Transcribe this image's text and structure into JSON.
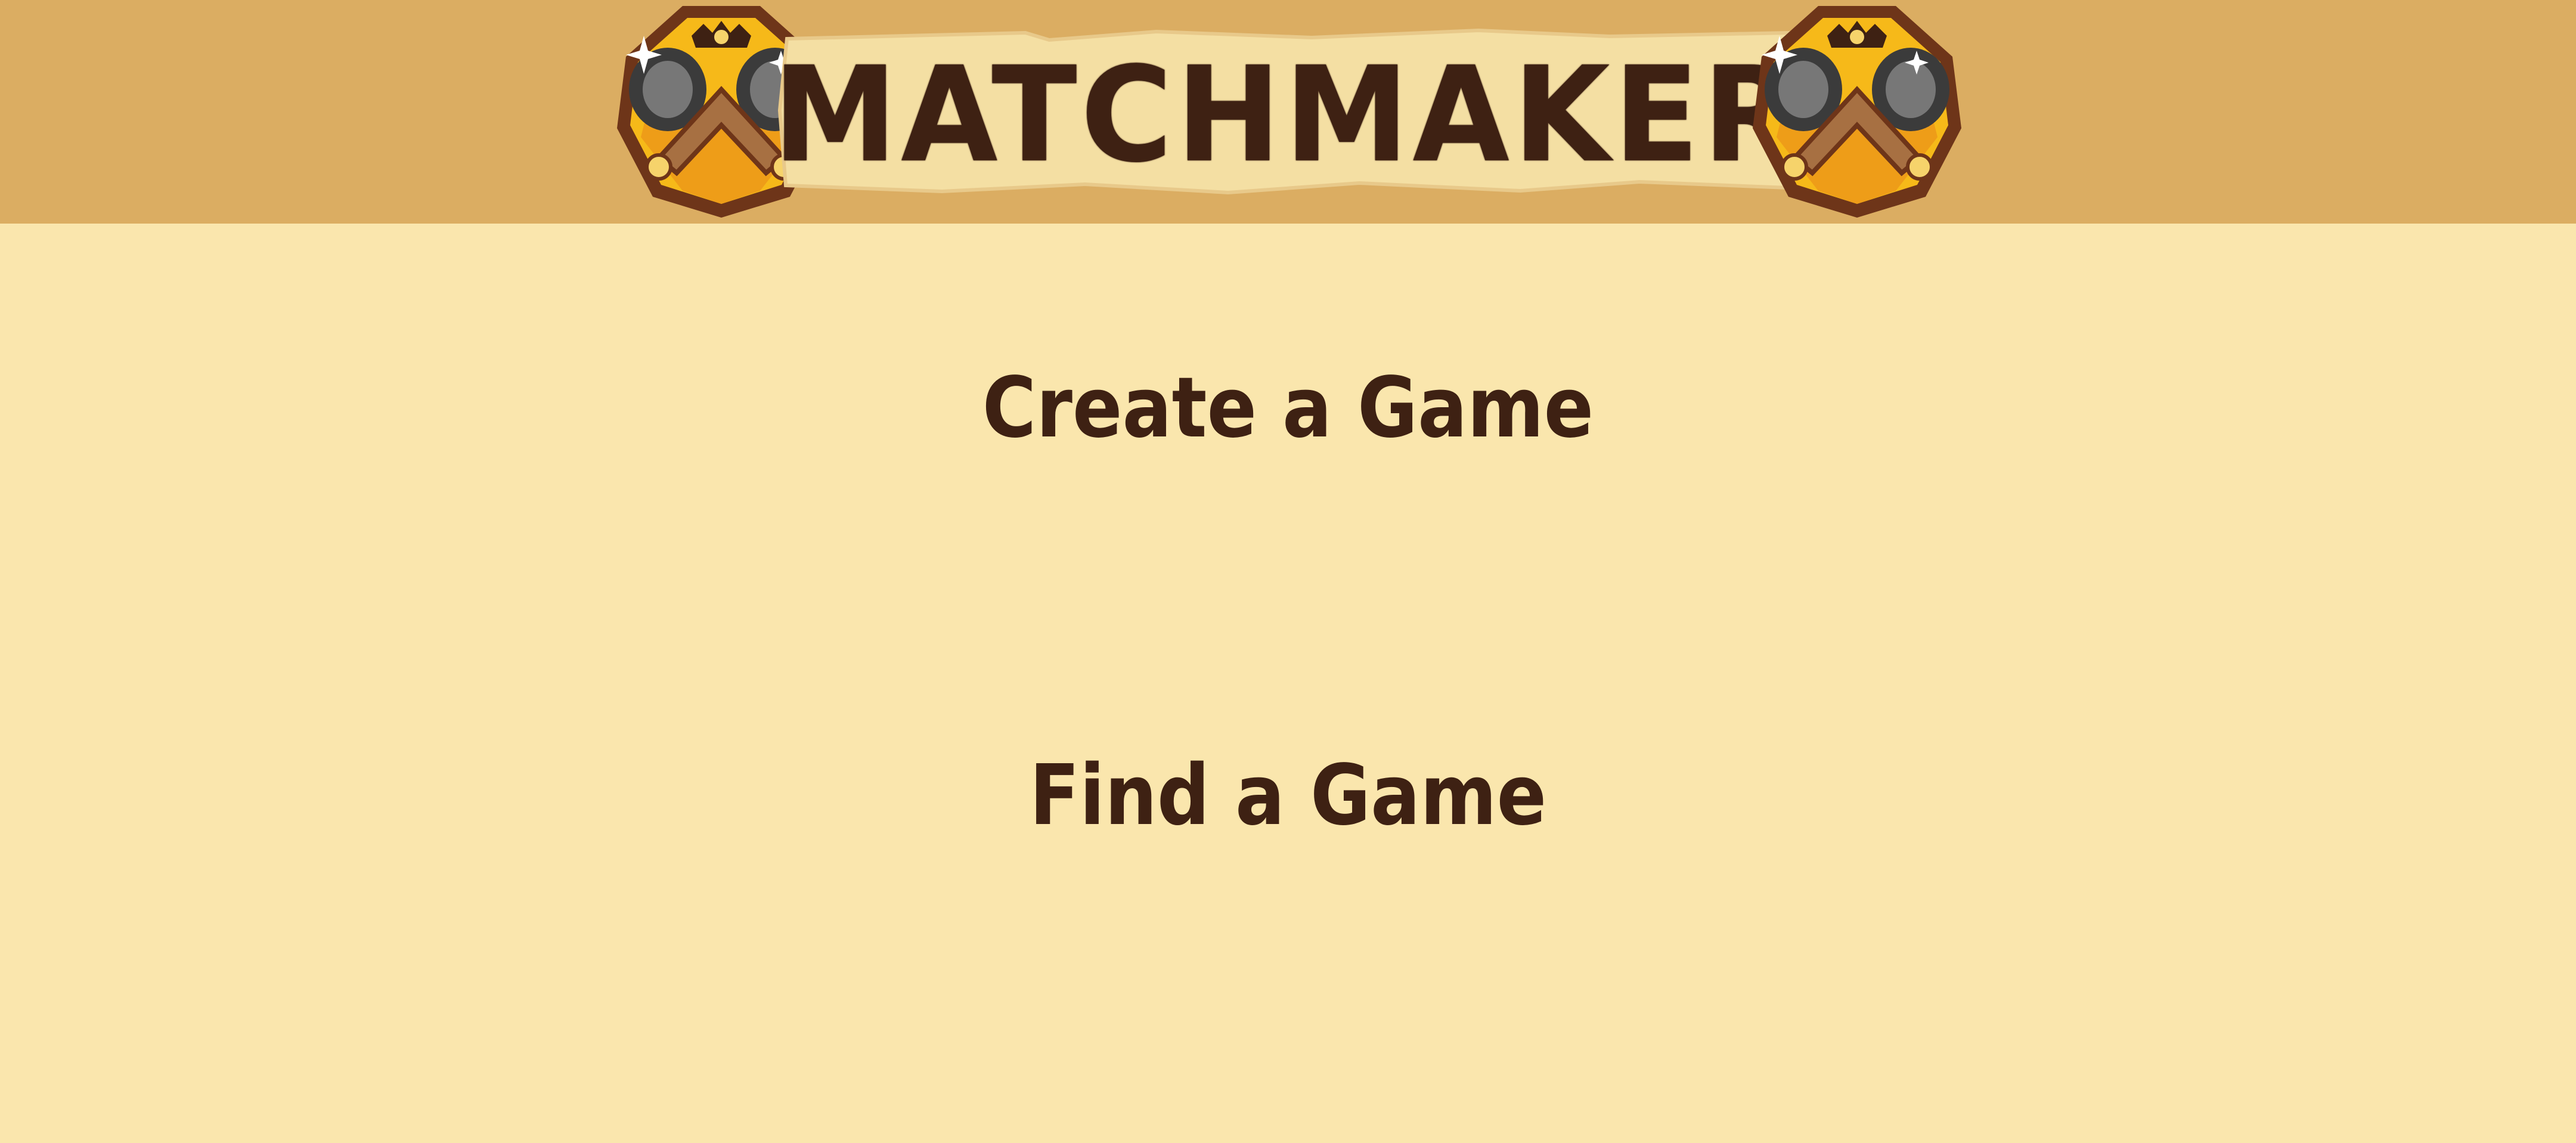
{
  "header": {
    "title": "MATCHMAKER",
    "emblem_icon": "crossed-cannons-emblem-icon"
  },
  "menu": {
    "create_label": "Create a Game",
    "find_label": "Find a Game"
  },
  "colors": {
    "background": "#fae6ad",
    "header_bar": "#dbad62",
    "scroll": "#f4dfa3",
    "text": "#3e2113",
    "emblem_gold": "#f6b919",
    "emblem_rim": "#6e3519"
  }
}
